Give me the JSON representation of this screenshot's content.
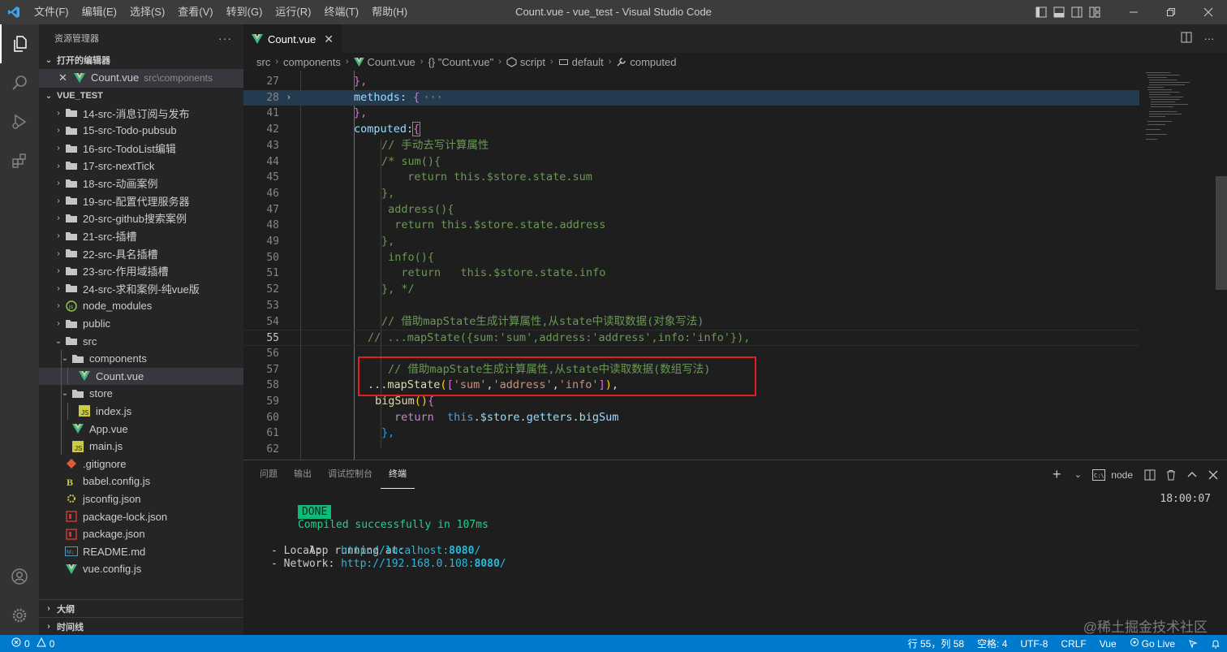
{
  "titlebar": {
    "menu": [
      "文件(F)",
      "编辑(E)",
      "选择(S)",
      "查看(V)",
      "转到(G)",
      "运行(R)",
      "终端(T)",
      "帮助(H)"
    ],
    "title": "Count.vue - vue_test - Visual Studio Code"
  },
  "sidebar": {
    "header": "资源管理器",
    "more": "···",
    "open_editors_title": "打开的编辑器",
    "open_editor": {
      "name": "Count.vue",
      "path": "src\\components"
    },
    "project_title": "VUE_TEST",
    "folders": [
      "14-src-消息订阅与发布",
      "15-src-Todo-pubsub",
      "16-src-TodoList编辑",
      "17-src-nextTick",
      "18-src-动画案例",
      "19-src-配置代理服务器",
      "20-src-github搜索案例",
      "21-src-插槽",
      "22-src-具名插槽",
      "23-src-作用域插槽",
      "24-src-求和案例-纯vue版",
      "node_modules",
      "public",
      "src"
    ],
    "src_children": {
      "components": "components",
      "count_vue": "Count.vue",
      "store": "store",
      "index_js": "index.js",
      "app_vue": "App.vue",
      "main_js": "main.js"
    },
    "root_files": [
      ".gitignore",
      "babel.config.js",
      "jsconfig.json",
      "package-lock.json",
      "package.json",
      "README.md",
      "vue.config.js"
    ],
    "outline": "大纲",
    "timeline": "时间线"
  },
  "editor": {
    "tab": "Count.vue",
    "breadcrumb": [
      "src",
      "components",
      "Count.vue",
      "{} \"Count.vue\"",
      "script",
      "default",
      "computed"
    ],
    "line_numbers": [
      "27",
      "28",
      "41",
      "42",
      "43",
      "44",
      "45",
      "46",
      "47",
      "48",
      "49",
      "50",
      "51",
      "52",
      "53",
      "54",
      "55",
      "56",
      "57",
      "58",
      "59",
      "60",
      "61",
      "62"
    ],
    "code": {
      "l27": "},",
      "l28a": "methods",
      "l28b": ": ",
      "l28c": "{",
      "l28d": "···",
      "l41": "},",
      "l42a": "computed",
      "l42b": ":",
      "l42c": "{",
      "l43": "// 手动去写计算属性",
      "l44": "/* sum(){",
      "l45": "  return this.$store.state.sum",
      "l46": "},",
      "l47": " address(){",
      "l48": "  return this.$store.state.address",
      "l49": "},",
      "l50": " info(){",
      "l51": "   return   this.$store.state.info",
      "l52": "}, */",
      "l54": "// 借助mapState生成计算属性,从state中读取数据(对象写法)",
      "l55": "// ...mapState({sum:'sum',address:'address',info:'info'}),",
      "l57": "// 借助mapState生成计算属性,从state中读取数据(数组写法)",
      "l58a": "...",
      "l58b": "mapState",
      "l58c": "(",
      "l58d": "[",
      "l58e": "'sum'",
      "l58f": ",",
      "l58g": "'address'",
      "l58h": ",",
      "l58i": "'info'",
      "l58j": "]",
      "l58k": ")",
      "l58l": ",",
      "l59a": "bigSum",
      "l59b": "()",
      "l59c": "{",
      "l60a": "return",
      "l60b": "this",
      "l60c": ".",
      "l60d": "$store",
      "l60e": ".",
      "l60f": "getters",
      "l60g": ".",
      "l60h": "bigSum",
      "l61": "},"
    }
  },
  "panel": {
    "tabs": [
      "问题",
      "输出",
      "调试控制台",
      "终端"
    ],
    "shell": "node",
    "done_badge": "DONE",
    "compiled": "Compiled successfully in 107ms",
    "time": "18:00:07",
    "running": "App running at:",
    "local_label": "- Local:   ",
    "local_url_a": "http://localhost:",
    "local_url_port": "8080",
    "local_url_end": "/",
    "network_label": "- Network: ",
    "network_url_a": "http://192.168.0.108:",
    "network_url_port": "8080",
    "network_url_end": "/"
  },
  "statusbar": {
    "errors": "0",
    "warnings": "0",
    "position": "行 55，列 58",
    "spaces": "空格: 4",
    "encoding": "UTF-8",
    "eol": "CRLF",
    "language": "Vue",
    "golive": "Go Live"
  },
  "watermark": "@稀土掘金技术社区",
  "colors": {
    "statusbar": "#007acc",
    "accent_box": "#e02020"
  }
}
